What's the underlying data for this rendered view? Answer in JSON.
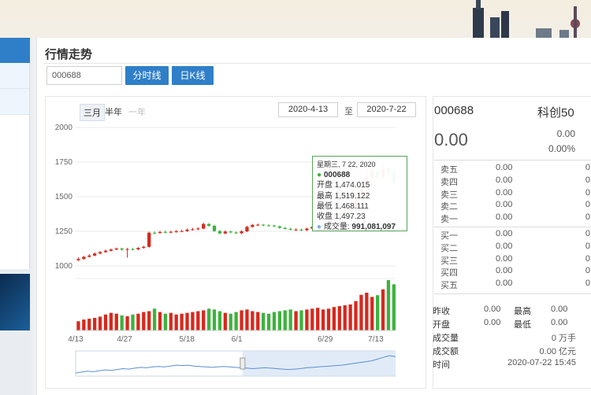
{
  "page": {
    "title": "行情走势"
  },
  "controls": {
    "code_value": "000688",
    "btn_fenshi": "分时线",
    "btn_kline": "日K线",
    "ranges": [
      "三月",
      "半年",
      "一年"
    ],
    "date_from": "2020-4-13",
    "date_sep": "至",
    "date_to": "2020-7-22"
  },
  "quote": {
    "code": "000688",
    "name": "科创50",
    "price": "0.00",
    "change": "0.00",
    "change_pct": "0.00%"
  },
  "order_book": {
    "asks": [
      {
        "label": "卖五",
        "price": "0.00",
        "vol": "0"
      },
      {
        "label": "卖四",
        "price": "0.00",
        "vol": "0"
      },
      {
        "label": "卖三",
        "price": "0.00",
        "vol": "0"
      },
      {
        "label": "卖二",
        "price": "0.00",
        "vol": "0"
      },
      {
        "label": "卖一",
        "price": "0.00",
        "vol": "0"
      }
    ],
    "bids": [
      {
        "label": "买一",
        "price": "0.00",
        "vol": "0"
      },
      {
        "label": "买二",
        "price": "0.00",
        "vol": "0"
      },
      {
        "label": "买三",
        "price": "0.00",
        "vol": "0"
      },
      {
        "label": "买四",
        "price": "0.00",
        "vol": "0"
      },
      {
        "label": "买五",
        "price": "0.00",
        "vol": "0"
      }
    ]
  },
  "stats": {
    "prev_close_label": "昨收",
    "prev_close": "0.00",
    "high_label": "最高",
    "high": "0.00",
    "open_label": "开盘",
    "open": "0.00",
    "low_label": "最低",
    "low": "0.00",
    "volume_label": "成交量",
    "volume": "0 万手",
    "amount_label": "成交额",
    "amount": "0.00 亿元",
    "time_label": "时间",
    "time": "2020-07-22 15:45"
  },
  "tooltip": {
    "date": "星期三, 7 22, 2020",
    "code": "000688",
    "open": "开盘 1,474.015",
    "high": "最高 1,519.122",
    "low": "最低 1,468.111",
    "close": "收盘 1,497.23",
    "volume_label": "成交量:",
    "volume": "991,081,097"
  },
  "colors": {
    "up": "#d7281c",
    "down": "#3eb23e",
    "accent": "#2f7fc8"
  },
  "chart_data": {
    "type": "candlestick",
    "y_ticks": [
      "2000",
      "1750",
      "1500",
      "1250",
      "1000"
    ],
    "ylim": [
      1000,
      2000
    ],
    "x_ticks": [
      "4/13",
      "4/27",
      "5/18",
      "6/1",
      "6/29",
      "7/13"
    ],
    "candles": [
      [
        1041,
        1050,
        1062,
        1036
      ],
      [
        1050,
        1066,
        1072,
        1045
      ],
      [
        1066,
        1075,
        1085,
        1060
      ],
      [
        1075,
        1090,
        1098,
        1070
      ],
      [
        1090,
        1100,
        1108,
        1084
      ],
      [
        1100,
        1110,
        1118,
        1094
      ],
      [
        1110,
        1119,
        1126,
        1104
      ],
      [
        1119,
        1126,
        1133,
        1113
      ],
      [
        1126,
        1118,
        1132,
        1108
      ],
      [
        1118,
        1122,
        1130,
        1060
      ],
      [
        1122,
        1120,
        1132,
        1112
      ],
      [
        1120,
        1130,
        1136,
        1114
      ],
      [
        1130,
        1138,
        1146,
        1124
      ],
      [
        1138,
        1240,
        1248,
        1132
      ],
      [
        1240,
        1238,
        1250,
        1228
      ],
      [
        1238,
        1245,
        1254,
        1232
      ],
      [
        1245,
        1242,
        1258,
        1236
      ],
      [
        1242,
        1246,
        1255,
        1236
      ],
      [
        1246,
        1250,
        1260,
        1240
      ],
      [
        1250,
        1252,
        1262,
        1244
      ],
      [
        1252,
        1262,
        1270,
        1246
      ],
      [
        1262,
        1265,
        1275,
        1256
      ],
      [
        1265,
        1270,
        1280,
        1258
      ],
      [
        1270,
        1303,
        1312,
        1264
      ],
      [
        1303,
        1290,
        1310,
        1282
      ],
      [
        1290,
        1252,
        1298,
        1246
      ],
      [
        1252,
        1235,
        1260,
        1228
      ],
      [
        1235,
        1248,
        1256,
        1228
      ],
      [
        1248,
        1242,
        1256,
        1235
      ],
      [
        1242,
        1236,
        1250,
        1230
      ],
      [
        1236,
        1250,
        1258,
        1230
      ],
      [
        1250,
        1282,
        1290,
        1244
      ],
      [
        1282,
        1296,
        1304,
        1276
      ],
      [
        1296,
        1298,
        1306,
        1288
      ],
      [
        1298,
        1293,
        1304,
        1286
      ],
      [
        1293,
        1292,
        1302,
        1286
      ],
      [
        1292,
        1286,
        1298,
        1280
      ],
      [
        1286,
        1275,
        1292,
        1268
      ],
      [
        1275,
        1268,
        1282,
        1262
      ],
      [
        1268,
        1262,
        1276,
        1256
      ],
      [
        1262,
        1262,
        1272,
        1254
      ],
      [
        1262,
        1258,
        1270,
        1252
      ],
      [
        1258,
        1270,
        1276,
        1252
      ],
      [
        1270,
        1282,
        1290,
        1264
      ],
      [
        1282,
        1290,
        1298,
        1276
      ],
      [
        1290,
        1300,
        1308,
        1284
      ],
      [
        1300,
        1330,
        1340,
        1294
      ],
      [
        1330,
        1350,
        1360,
        1322
      ],
      [
        1350,
        1383,
        1392,
        1344
      ],
      [
        1383,
        1400,
        1410,
        1376
      ],
      [
        1400,
        1412,
        1420,
        1394
      ],
      [
        1412,
        1500,
        1520,
        1406
      ],
      [
        1500,
        1560,
        1600,
        1490
      ],
      [
        1560,
        1640,
        1700,
        1552
      ],
      [
        1640,
        1680,
        1740,
        1630
      ],
      [
        1680,
        1640,
        1700,
        1620
      ],
      [
        1640,
        1700,
        1740,
        1630
      ],
      [
        1700,
        1680,
        1720,
        1650
      ],
      [
        1680,
        1600,
        1700,
        1580
      ],
      [
        1600,
        1530,
        1620,
        1500
      ],
      [
        1530,
        1480,
        1540,
        1470
      ],
      [
        1474,
        1497,
        1519,
        1468
      ]
    ],
    "volumes": [
      22,
      26,
      28,
      30,
      33,
      38,
      42,
      40,
      36,
      34,
      38,
      40,
      44,
      46,
      52,
      44,
      40,
      42,
      38,
      40,
      42,
      44,
      46,
      48,
      52,
      50,
      46,
      42,
      40,
      44,
      48,
      50,
      46,
      44,
      42,
      40,
      44,
      46,
      48,
      50,
      46,
      48,
      50,
      52,
      54,
      50,
      52,
      56,
      58,
      60,
      62,
      70,
      85,
      90,
      80,
      84,
      98,
      120,
      110,
      100,
      70,
      86
    ],
    "navigator": [
      40,
      42,
      44,
      43,
      45,
      47,
      46,
      48,
      50,
      49,
      51,
      53,
      52,
      54,
      55,
      54,
      56,
      58,
      57,
      58,
      56,
      55,
      54,
      53,
      54,
      55,
      54,
      53,
      52,
      51,
      50,
      51,
      52,
      51,
      50,
      49,
      48,
      49,
      50,
      52,
      53,
      54,
      55,
      56,
      57,
      58,
      60,
      62,
      64,
      66,
      68,
      72,
      76,
      80,
      78,
      74,
      70,
      66
    ]
  }
}
